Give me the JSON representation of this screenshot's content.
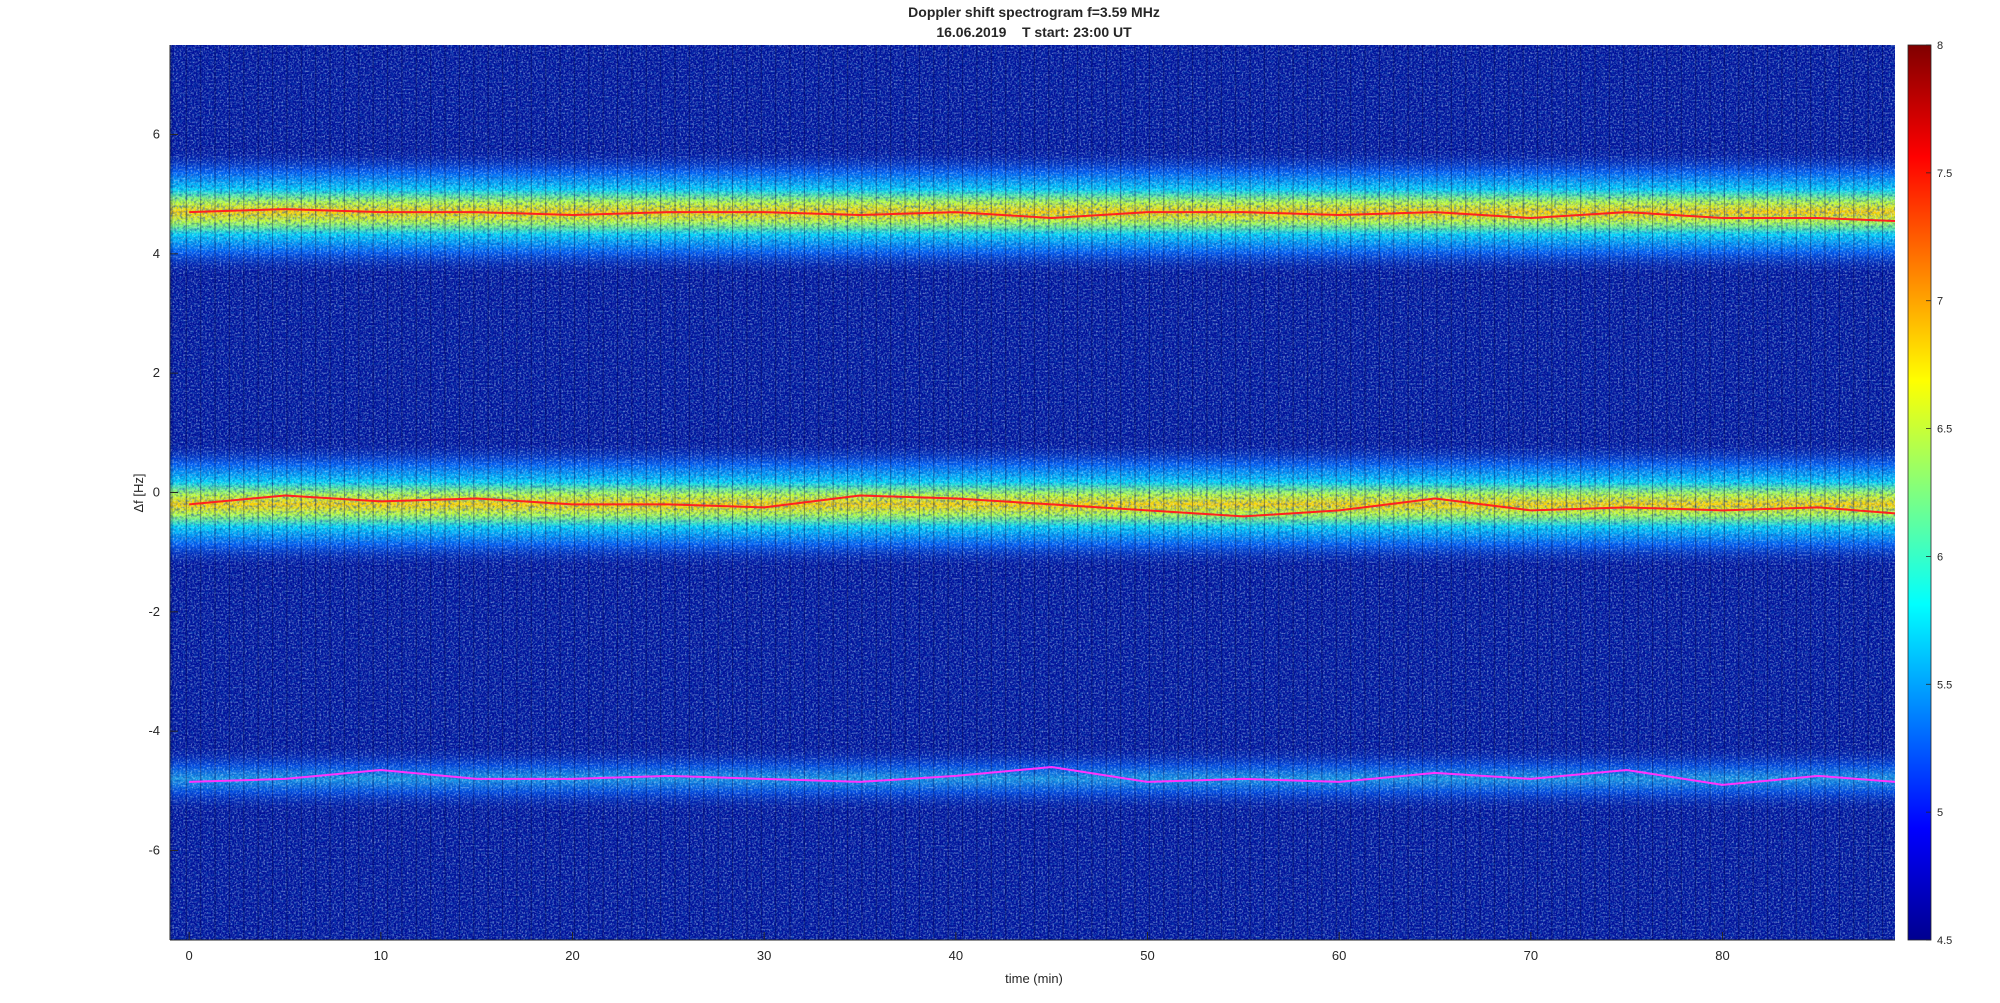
{
  "chart_data": {
    "type": "heatmap",
    "title": "Doppler shift spectrogram f=3.59 MHz",
    "subtitle": "16.06.2019    T start: 23:00 UT",
    "xlabel": "time (min)",
    "ylabel": "Δf [Hz]",
    "xlim": [
      -1,
      89
    ],
    "ylim": [
      -7.5,
      7.5
    ],
    "x_ticks": [
      0,
      10,
      20,
      30,
      40,
      50,
      60,
      70,
      80
    ],
    "y_ticks": [
      -6,
      -4,
      -2,
      0,
      2,
      4,
      6
    ],
    "colorbar": {
      "colormap": "jet",
      "range": [
        4.5,
        8
      ],
      "ticks": [
        "4.5",
        "5",
        "5.5",
        "6",
        "6.5",
        "7",
        "7.5",
        "8"
      ]
    },
    "bands": [
      {
        "center_hz": 4.7,
        "intensity": "high"
      },
      {
        "center_hz": -0.2,
        "intensity": "high"
      },
      {
        "center_hz": -4.8,
        "intensity": "low"
      }
    ],
    "series": [
      {
        "color": "#ff2020",
        "x": [
          0,
          5,
          10,
          15,
          20,
          25,
          30,
          35,
          40,
          45,
          50,
          55,
          60,
          65,
          70,
          75,
          80,
          85,
          89
        ],
        "y": [
          4.7,
          4.75,
          4.7,
          4.7,
          4.65,
          4.7,
          4.7,
          4.65,
          4.7,
          4.6,
          4.7,
          4.7,
          4.65,
          4.7,
          4.6,
          4.7,
          4.6,
          4.6,
          4.55
        ]
      },
      {
        "color": "#ff2020",
        "x": [
          0,
          5,
          10,
          15,
          20,
          25,
          30,
          35,
          40,
          45,
          50,
          55,
          60,
          65,
          70,
          75,
          80,
          85,
          89
        ],
        "y": [
          -0.2,
          -0.05,
          -0.15,
          -0.1,
          -0.2,
          -0.2,
          -0.25,
          -0.05,
          -0.1,
          -0.2,
          -0.3,
          -0.4,
          -0.3,
          -0.1,
          -0.3,
          -0.25,
          -0.3,
          -0.25,
          -0.35
        ]
      },
      {
        "color": "#ff33ff",
        "x": [
          0,
          5,
          10,
          15,
          20,
          25,
          30,
          35,
          40,
          45,
          50,
          55,
          60,
          65,
          70,
          75,
          80,
          85,
          89
        ],
        "y": [
          -4.85,
          -4.8,
          -4.65,
          -4.8,
          -4.8,
          -4.75,
          -4.8,
          -4.85,
          -4.75,
          -4.6,
          -4.85,
          -4.8,
          -4.85,
          -4.7,
          -4.8,
          -4.65,
          -4.9,
          -4.75,
          -4.85
        ]
      }
    ]
  }
}
